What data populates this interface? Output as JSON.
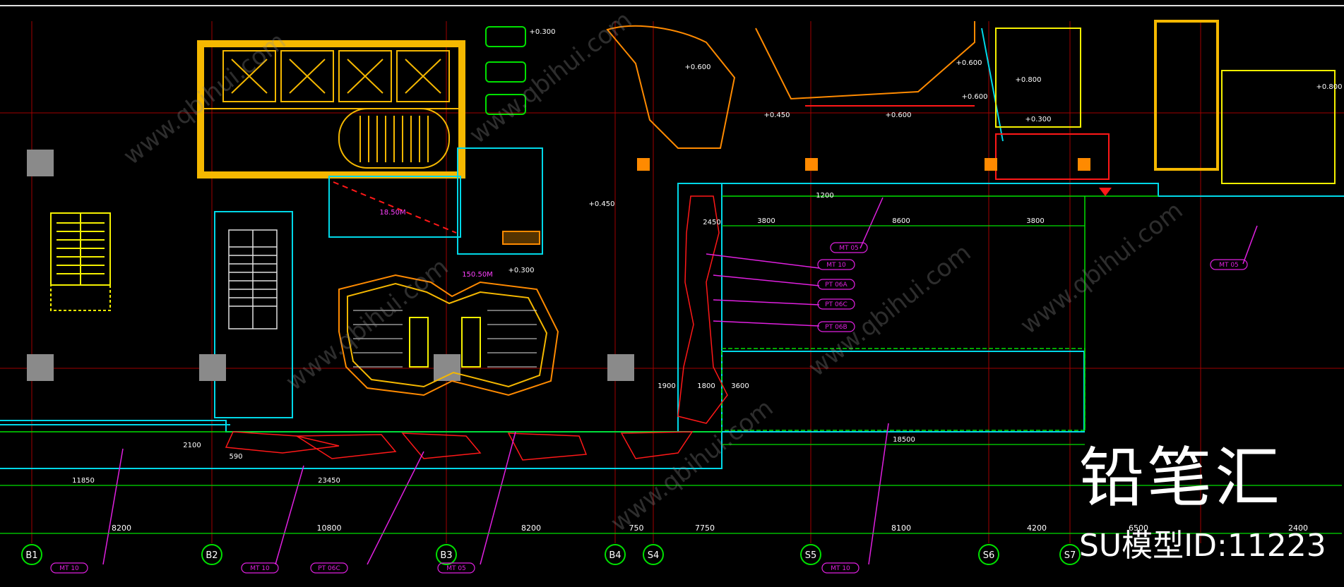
{
  "drawing": {
    "colors": {
      "background": "#000000",
      "wall_yellow": "#f5b800",
      "cyan": "#00d8e8",
      "green": "#00e000",
      "red": "#ff1818",
      "orange": "#ff8a00",
      "magenta": "#e020e0",
      "grid_red": "#a00000",
      "white": "#ffffff",
      "grey_block": "#8a8a8a"
    },
    "axis_labels": [
      "B1",
      "B2",
      "B3",
      "B4",
      "S4",
      "S5",
      "S6",
      "S7"
    ],
    "span_dimensions": [
      "8200",
      "10800",
      "8200",
      "750",
      "7750",
      "8100",
      "4200",
      "6500",
      "2400"
    ],
    "overall_dimensions": [
      "11850",
      "23450",
      "18500",
      "3800",
      "8600",
      "3800",
      "1900",
      "1800",
      "3600",
      "2100",
      "2450",
      "1200",
      "590"
    ],
    "elevation_marks": [
      "+0.300",
      "+0.600",
      "+0.450",
      "+0.600",
      "+0.600",
      "+0.800",
      "+0.300",
      "+0.300",
      "+0.450",
      "+0.800",
      "+0.600"
    ],
    "material_tags": [
      "MT 05",
      "MT 10",
      "PT 06A",
      "PT 06C",
      "PT 06B",
      "MT 10",
      "MT 10",
      "PT 06C",
      "MT 05",
      "MT 10",
      "MT 05"
    ],
    "room_labels": [
      "18.50M",
      "150.50M"
    ]
  },
  "watermark": {
    "brand": "铅笔汇",
    "model_id": "SU模型ID:11223",
    "url_text": "www.qbihui.com"
  }
}
